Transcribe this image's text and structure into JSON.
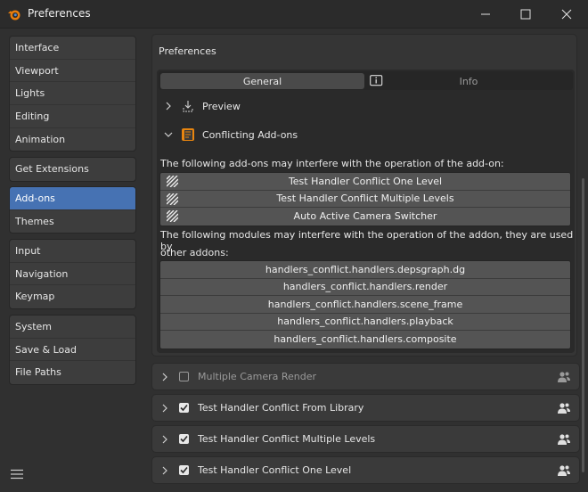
{
  "window": {
    "title": "Preferences",
    "controls": [
      "minimize-icon",
      "maximize-icon",
      "close-icon"
    ]
  },
  "sidebar": {
    "groups": [
      [
        {
          "label": "Interface"
        },
        {
          "label": "Viewport"
        },
        {
          "label": "Lights"
        },
        {
          "label": "Editing"
        },
        {
          "label": "Animation"
        }
      ],
      [
        {
          "label": "Get Extensions"
        }
      ],
      [
        {
          "label": "Add-ons",
          "active": true
        },
        {
          "label": "Themes"
        }
      ],
      [
        {
          "label": "Input"
        },
        {
          "label": "Navigation"
        },
        {
          "label": "Keymap"
        }
      ],
      [
        {
          "label": "System"
        },
        {
          "label": "Save & Load"
        },
        {
          "label": "File Paths"
        }
      ]
    ]
  },
  "panel": {
    "title": "Preferences",
    "tabs": {
      "general": "General",
      "info": "Info"
    },
    "preview_label": "Preview",
    "conflicting_label": "Conflicting Add-ons",
    "addons_intro": "The following add-ons may interfere with the operation of the add-on:",
    "addons": [
      "Test Handler Conflict One Level",
      "Test Handler Conflict Multiple Levels",
      "Auto Active Camera Switcher"
    ],
    "modules_intro_1": "The following modules may interfere with the operation of the addon, they are used by",
    "modules_intro_2": "other addons:",
    "modules": [
      "handlers_conflict.handlers.depsgraph.dg",
      "handlers_conflict.handlers.render",
      "handlers_conflict.handlers.scene_frame",
      "handlers_conflict.handlers.playback",
      "handlers_conflict.handlers.composite"
    ]
  },
  "addon_rows": [
    {
      "label": "Multiple Camera Render",
      "enabled": false
    },
    {
      "label": "Test Handler Conflict From Library",
      "enabled": true
    },
    {
      "label": "Test Handler Conflict Multiple Levels",
      "enabled": true
    },
    {
      "label": "Test Handler Conflict One Level",
      "enabled": true
    }
  ],
  "colors": {
    "accent": "#4672b3",
    "background": "#303030",
    "panel": "#353535"
  }
}
